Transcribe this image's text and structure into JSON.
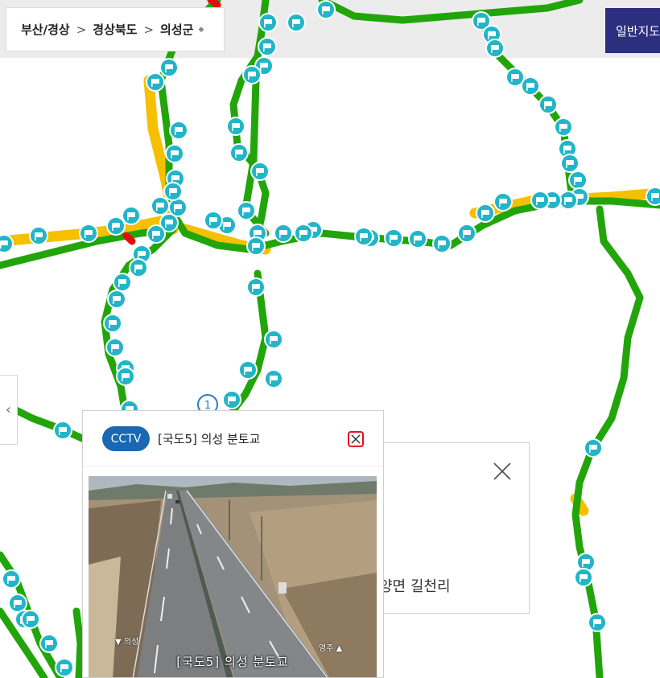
{
  "breadcrumb": {
    "region": "부산/경상",
    "province": "경상북도",
    "county": "의성군",
    "separator": ">"
  },
  "map_type_button": {
    "label": "일반지도"
  },
  "cluster_marker": {
    "count": "1"
  },
  "info_panel": {
    "address": "양면 길천리"
  },
  "cctv_popup": {
    "badge": "CCTV",
    "title": "[국도5] 의성 분토교",
    "video": {
      "caption": "[국도5] 의성 분토교",
      "direction_left": "의성",
      "direction_right": "영주"
    }
  },
  "legend_colors": {
    "smooth": "#22a50a",
    "slow": "#f5c000",
    "congested": "#e01010",
    "cctv_marker": "#22b5c8"
  },
  "icons": [
    "cctv-marker-icon",
    "chevron-left-icon",
    "close-icon",
    "dropdown-icon"
  ]
}
